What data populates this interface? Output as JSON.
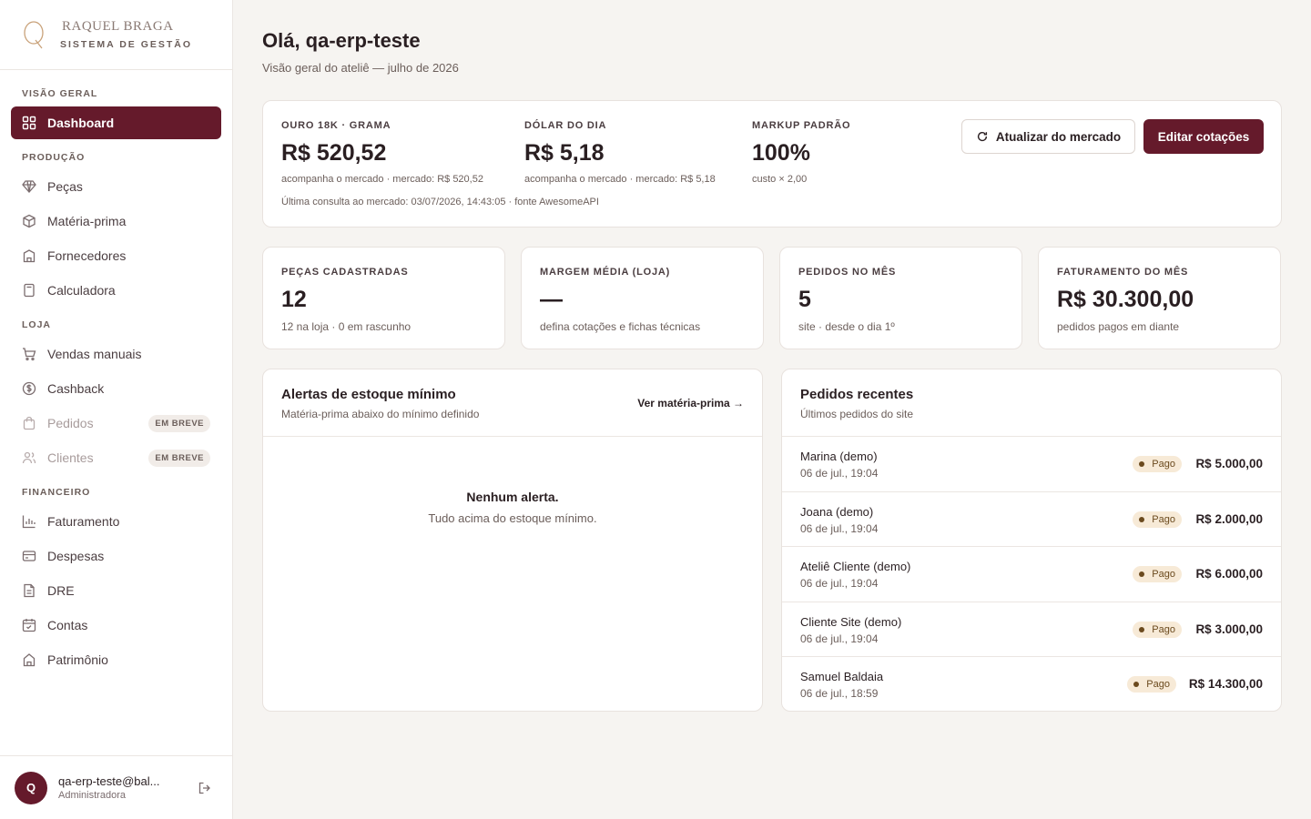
{
  "brand": {
    "name": "RAQUEL BRAGA",
    "subtitle": "SISTEMA DE GESTÃO",
    "logo_icon": "q-monogram-icon",
    "logo_color": "#c9a27a"
  },
  "colors": {
    "accent": "#651a2b",
    "badge_bg": "#f7ead7",
    "badge_text": "#6b4a1e"
  },
  "sidebar": {
    "sections": [
      {
        "title": "VISÃO GERAL",
        "items": [
          {
            "label": "Dashboard",
            "icon": "grid-icon",
            "active": true
          }
        ]
      },
      {
        "title": "PRODUÇÃO",
        "items": [
          {
            "label": "Peças",
            "icon": "gem-icon"
          },
          {
            "label": "Matéria-prima",
            "icon": "box-icon"
          },
          {
            "label": "Fornecedores",
            "icon": "building-icon"
          },
          {
            "label": "Calculadora",
            "icon": "calculator-icon"
          }
        ]
      },
      {
        "title": "LOJA",
        "items": [
          {
            "label": "Vendas manuais",
            "icon": "cart-icon"
          },
          {
            "label": "Cashback",
            "icon": "dollar-circle-icon"
          },
          {
            "label": "Pedidos",
            "icon": "bag-icon",
            "badge": "EM BREVE"
          },
          {
            "label": "Clientes",
            "icon": "users-icon",
            "badge": "EM BREVE"
          }
        ]
      },
      {
        "title": "FINANCEIRO",
        "items": [
          {
            "label": "Faturamento",
            "icon": "bar-chart-icon"
          },
          {
            "label": "Despesas",
            "icon": "credit-card-icon"
          },
          {
            "label": "DRE",
            "icon": "document-icon"
          },
          {
            "label": "Contas",
            "icon": "calendar-icon"
          },
          {
            "label": "Patrimônio",
            "icon": "bank-icon"
          }
        ]
      }
    ]
  },
  "user": {
    "initial": "Q",
    "email": "qa-erp-teste@bal...",
    "role": "Administradora",
    "logout_icon": "logout-icon"
  },
  "header": {
    "greeting": "Olá, qa-erp-teste",
    "subtitle": "Visão geral do ateliê — julho de 2026"
  },
  "quotes": {
    "gold": {
      "label": "OURO 18K · GRAMA",
      "value": "R$ 520,52",
      "note": "acompanha o mercado · mercado: R$ 520,52"
    },
    "dollar": {
      "label": "DÓLAR DO DIA",
      "value": "R$ 5,18",
      "note": "acompanha o mercado · mercado: R$ 5,18"
    },
    "markup": {
      "label": "MARKUP PADRÃO",
      "value": "100%",
      "note": "custo × 2,00"
    },
    "last_query": "Última consulta ao mercado: 03/07/2026, 14:43:05 · fonte AwesomeAPI",
    "refresh_label": "Atualizar do mercado",
    "edit_label": "Editar cotações"
  },
  "stats": [
    {
      "label": "PEÇAS CADASTRADAS",
      "value": "12",
      "note": "12 na loja · 0 em rascunho"
    },
    {
      "label": "MARGEM MÉDIA (LOJA)",
      "value": "—",
      "note": "defina cotações e fichas técnicas"
    },
    {
      "label": "PEDIDOS NO MÊS",
      "value": "5",
      "note": "site · desde o dia 1º"
    },
    {
      "label": "FATURAMENTO DO MÊS",
      "value": "R$ 30.300,00",
      "note": "pedidos pagos em diante"
    }
  ],
  "alerts": {
    "title": "Alertas de estoque mínimo",
    "subtitle": "Matéria-prima abaixo do mínimo definido",
    "link": "Ver matéria-prima →",
    "empty_title": "Nenhum alerta.",
    "empty_sub": "Tudo acima do estoque mínimo."
  },
  "orders": {
    "title": "Pedidos recentes",
    "subtitle": "Últimos pedidos do site",
    "items": [
      {
        "name": "Marina (demo)",
        "date": "06 de jul., 19:04",
        "status": "Pago",
        "amount": "R$ 5.000,00"
      },
      {
        "name": "Joana (demo)",
        "date": "06 de jul., 19:04",
        "status": "Pago",
        "amount": "R$ 2.000,00"
      },
      {
        "name": "Ateliê Cliente (demo)",
        "date": "06 de jul., 19:04",
        "status": "Pago",
        "amount": "R$ 6.000,00"
      },
      {
        "name": "Cliente Site (demo)",
        "date": "06 de jul., 19:04",
        "status": "Pago",
        "amount": "R$ 3.000,00"
      },
      {
        "name": "Samuel Baldaia",
        "date": "06 de jul., 18:59",
        "status": "Pago",
        "amount": "R$ 14.300,00"
      }
    ]
  }
}
